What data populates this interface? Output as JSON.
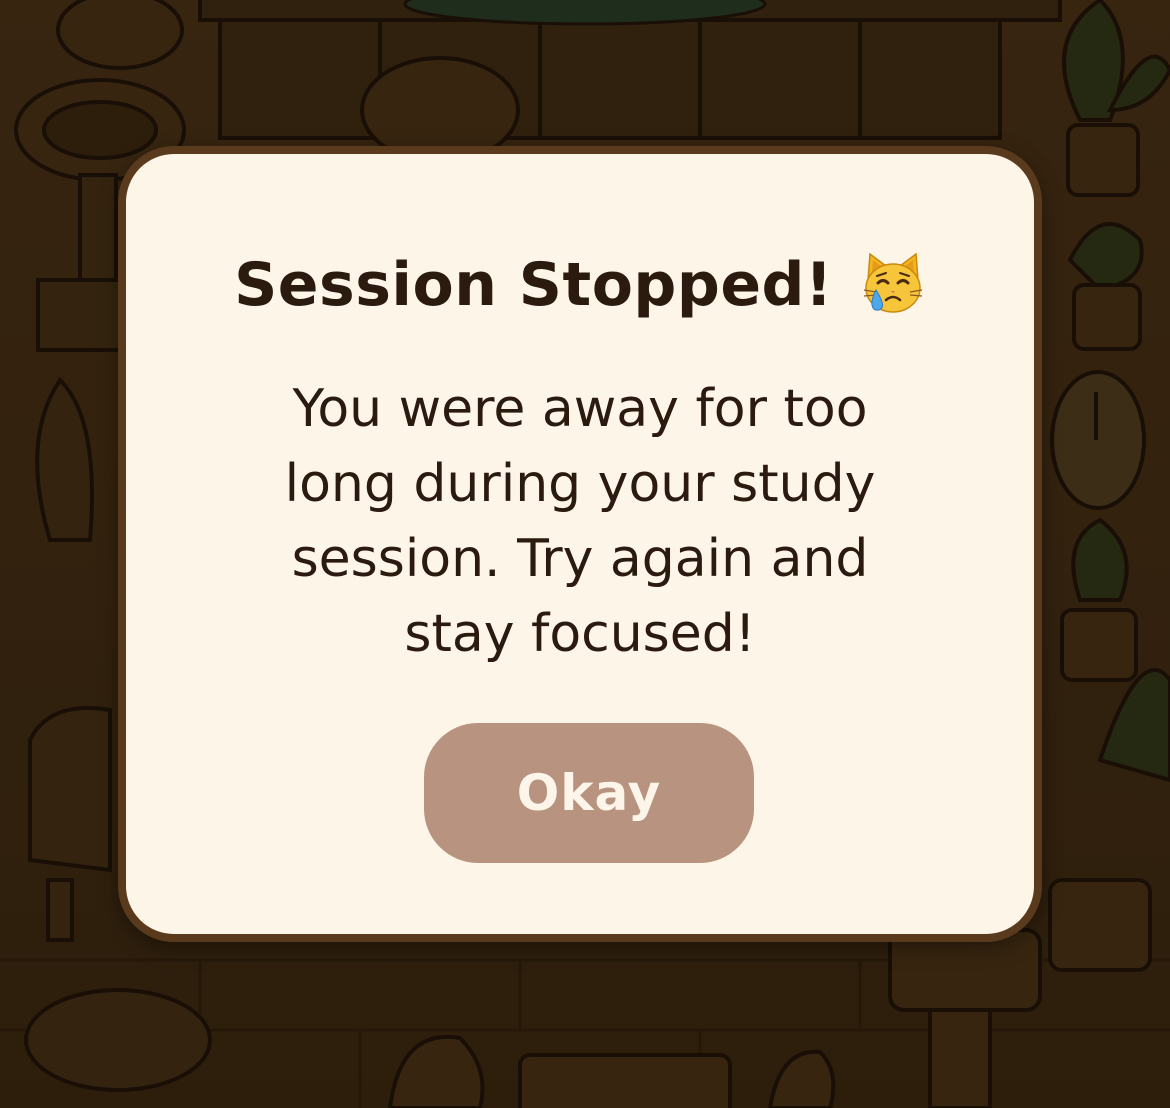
{
  "dialog": {
    "title": "Session Stopped!",
    "title_icon": "crying-cat-face",
    "message": "You were away for too long during your study session. Try again and stay focused!",
    "button_label": "Okay"
  },
  "colors": {
    "dialog_background": "#fdf5e8",
    "dialog_border": "#5a3a1c",
    "text": "#2b1a0e",
    "button": "#b8937f",
    "button_text": "#fdf5ea"
  }
}
